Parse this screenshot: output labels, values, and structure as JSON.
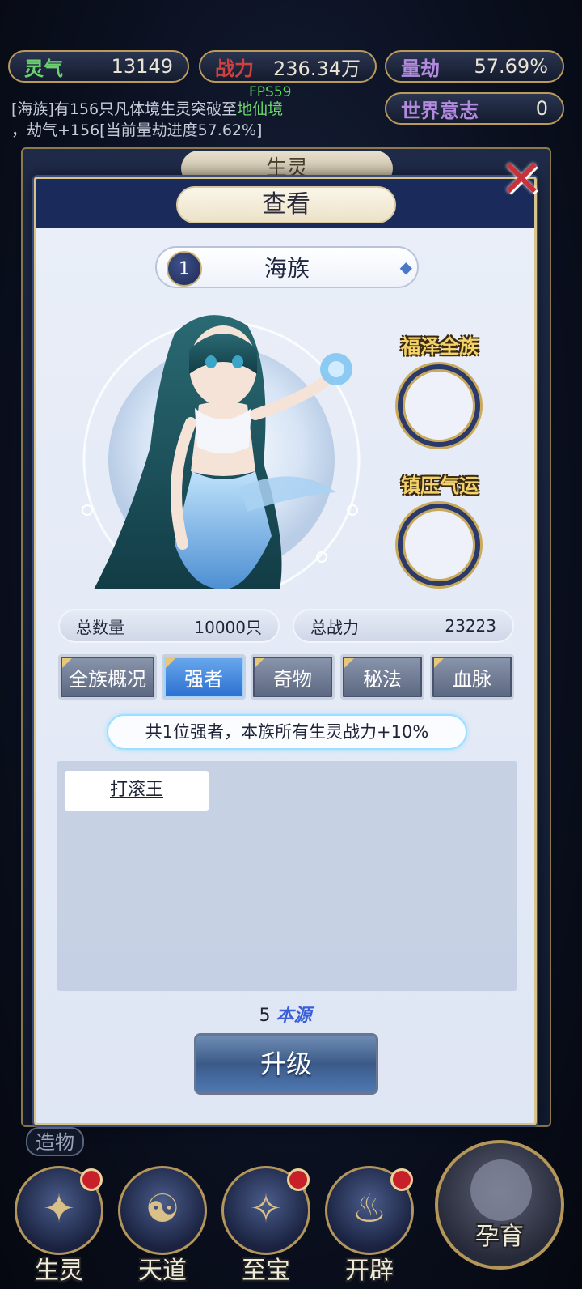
{
  "top_bar": {
    "lingqi": {
      "label": "灵气",
      "value": "13149"
    },
    "zhanli": {
      "label": "战力",
      "value": "236.34万"
    },
    "liangjie": {
      "label": "量劫",
      "value": "57.69%"
    },
    "shijie": {
      "label": "世界意志",
      "value": "0"
    }
  },
  "fps": "FPS59",
  "log": {
    "line1_a": "[海族]有156只凡体境生灵突破至",
    "line1_hl": "地仙境",
    "line2": "，劫气+156[当前量劫进度57.62%]"
  },
  "background_panel_title": "生灵",
  "dialog": {
    "title": "查看",
    "close_icon": "close-x-icon",
    "race": {
      "index": "1",
      "name": "海族"
    },
    "side": {
      "label1": "福泽全族",
      "label2": "镇压气运"
    },
    "stats": {
      "count_label": "总数量",
      "count_value": "10000只",
      "power_label": "总战力",
      "power_value": "23223"
    },
    "tabs": [
      "全族概况",
      "强者",
      "奇物",
      "秘法",
      "血脉"
    ],
    "active_tab": 1,
    "notice": "共1位强者，本族所有生灵战力+10%",
    "list": [
      "打滚王"
    ],
    "cost": {
      "amount": "5",
      "resource": "本源"
    },
    "upgrade_label": "升级"
  },
  "zaowu_label": "造物",
  "bottom_nav": [
    {
      "label": "生灵",
      "icon": "spirit-icon",
      "glyph": "✦"
    },
    {
      "label": "天道",
      "icon": "swirl-icon",
      "glyph": "☯"
    },
    {
      "label": "至宝",
      "icon": "treasure-icon",
      "glyph": "✧"
    },
    {
      "label": "开辟",
      "icon": "flame-icon",
      "glyph": "♨"
    }
  ],
  "big_button": {
    "label": "孕育",
    "icon": "nurture-icon"
  },
  "colors": {
    "accent_gold": "#d7c48a",
    "active_tab": "#2c6fd0",
    "close_red": "#c8323a"
  }
}
